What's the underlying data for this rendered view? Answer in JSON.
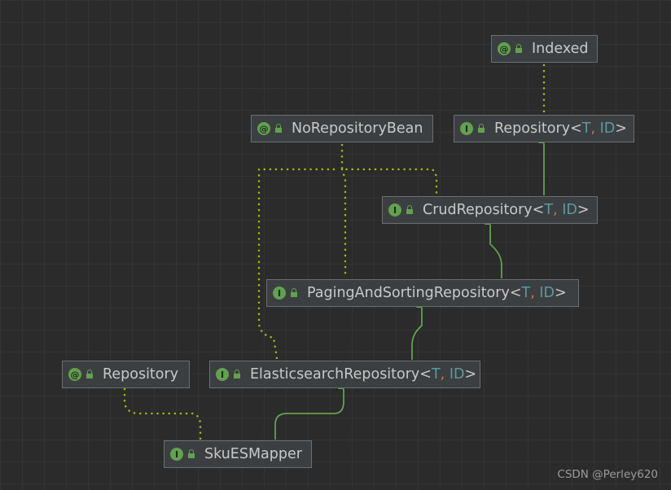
{
  "nodes": [
    {
      "id": "indexed",
      "kind": "@",
      "name": "Indexed",
      "generic": false
    },
    {
      "id": "repository-generic",
      "kind": "I",
      "name": "Repository",
      "generic": true
    },
    {
      "id": "no-repository-bean",
      "kind": "@",
      "name": "NoRepositoryBean",
      "generic": false
    },
    {
      "id": "crud-repository",
      "kind": "I",
      "name": "CrudRepository",
      "generic": true
    },
    {
      "id": "paging-and-sorting-repository",
      "kind": "I",
      "name": "PagingAndSortingRepository",
      "generic": true
    },
    {
      "id": "repository-annotation",
      "kind": "@",
      "name": "Repository",
      "generic": false
    },
    {
      "id": "elasticsearch-repository",
      "kind": "I",
      "name": "ElasticsearchRepository",
      "generic": true
    },
    {
      "id": "sku-es-mapper",
      "kind": "I",
      "name": "SkuESMapper",
      "generic": false
    }
  ],
  "generic_params": {
    "t": "T",
    "id": "ID"
  },
  "generic_tokens": {
    "open": "<",
    "comma": ",",
    "close": ">"
  },
  "edges": {
    "extends": [
      {
        "from": "repository-generic",
        "to": "crud-repository"
      },
      {
        "from": "crud-repository",
        "to": "paging-and-sorting-repository"
      },
      {
        "from": "paging-and-sorting-repository",
        "to": "elasticsearch-repository"
      },
      {
        "from": "elasticsearch-repository",
        "to": "sku-es-mapper"
      }
    ],
    "annotations": [
      {
        "from": "indexed",
        "to": "repository-generic"
      },
      {
        "from": "no-repository-bean",
        "to": "crud-repository"
      },
      {
        "from": "no-repository-bean",
        "to": "paging-and-sorting-repository"
      },
      {
        "from": "no-repository-bean",
        "to": "elasticsearch-repository"
      },
      {
        "from": "repository-annotation",
        "to": "sku-es-mapper"
      }
    ]
  },
  "colors": {
    "background": "#2b2b2b",
    "node_background": "#3c3f41",
    "node_border": "#6b6e70",
    "extends_line": "#62a14f",
    "annotation_line": "#a8b800",
    "icon_green": "#62a14f",
    "type_param": "#5a9aa0",
    "punctuation": "#cc7832"
  },
  "watermark": "CSDN @Perley620"
}
